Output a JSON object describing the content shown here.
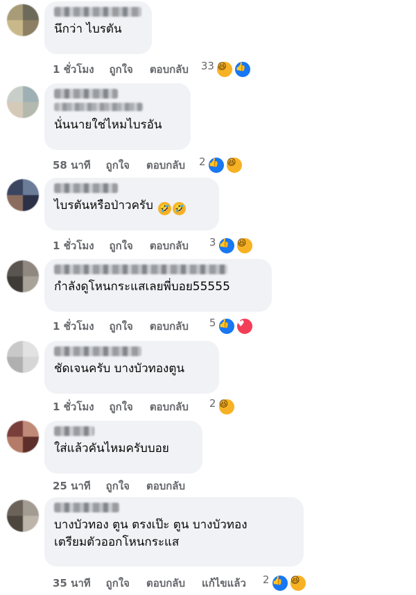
{
  "comments": [
    {
      "text": "นึกว่า ไบรตัน",
      "time": "1 ชั่วโมง",
      "like": "ถูกใจ",
      "reply": "ตอบกลับ",
      "edited": "",
      "count": "33",
      "reactions": [
        "haha",
        "like"
      ]
    },
    {
      "text": "นั่นนายใช่ไหมไบรอัน",
      "time": "58 นาที",
      "like": "ถูกใจ",
      "reply": "ตอบกลับ",
      "edited": "",
      "count": "2",
      "reactions": [
        "like",
        "haha"
      ]
    },
    {
      "text": "ไบรตันหรือป่าวครับ",
      "time": "1 ชั่วโมง",
      "like": "ถูกใจ",
      "reply": "ตอบกลับ",
      "edited": "",
      "count": "3",
      "reactions": [
        "like",
        "haha"
      ]
    },
    {
      "text": "กำลังดูโหนกระแสเลยพี่บอย55555",
      "time": "1 ชั่วโมง",
      "like": "ถูกใจ",
      "reply": "ตอบกลับ",
      "edited": "",
      "count": "5",
      "reactions": [
        "like",
        "love"
      ]
    },
    {
      "text": "ชัดเจนครับ บางบัวทองตูน",
      "time": "1 ชั่วโมง",
      "like": "ถูกใจ",
      "reply": "ตอบกลับ",
      "edited": "",
      "count": "2",
      "reactions": [
        "haha"
      ]
    },
    {
      "text": "ใส่แล้วคันไหมครับบอย",
      "time": "25 นาที",
      "like": "ถูกใจ",
      "reply": "ตอบกลับ",
      "edited": "",
      "count": "",
      "reactions": []
    },
    {
      "text": "บางบัวทอง ตูน ตรงเป๊ะ ตูน บางบัวทอง\nเตรียมตัวออกโหนกระแส",
      "time": "35 นาที",
      "like": "ถูกใจ",
      "reply": "ตอบกลับ",
      "edited": "แก้ไขแล้ว",
      "count": "2",
      "reactions": [
        "like",
        "haha"
      ]
    }
  ],
  "colors": {
    "bubble": "#f0f2f5",
    "like_blue": "#1877f2",
    "haha_yellow": "#f7b125",
    "love_red": "#f33e58",
    "meta_gray": "#65676b"
  },
  "icons": {
    "haha": "haha-reaction-icon",
    "like": "like-reaction-icon",
    "love": "love-reaction-icon",
    "laugh_emoji": "rolling-laughing-emoji-icon"
  }
}
